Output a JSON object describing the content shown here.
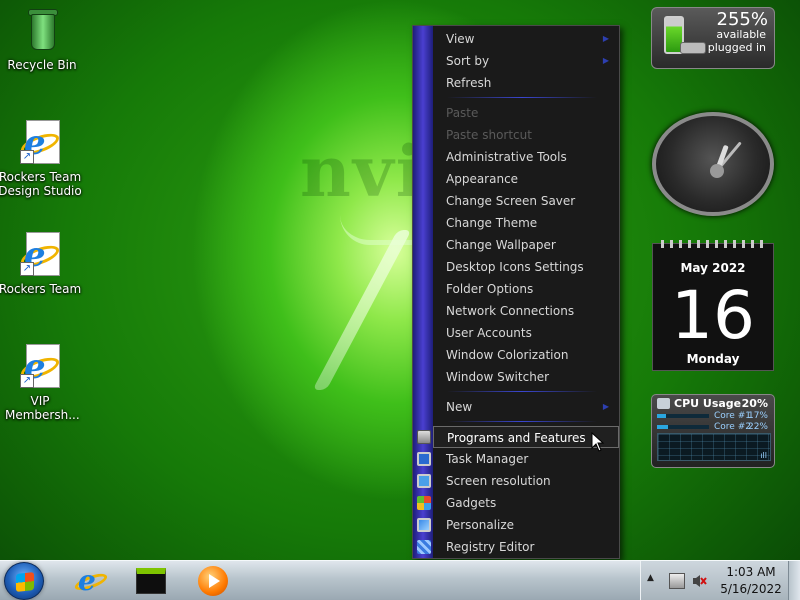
{
  "desktop": {
    "wallpaper_text": "nvi",
    "icons": [
      {
        "label": "Recycle Bin"
      },
      {
        "label": "Rockers Team Design Studio"
      },
      {
        "label": "Rockers Team"
      },
      {
        "label": "VIP Membersh..."
      }
    ]
  },
  "context_menu": {
    "items": [
      {
        "label": "View",
        "submenu": true
      },
      {
        "label": "Sort by",
        "submenu": true
      },
      {
        "label": "Refresh"
      },
      {
        "label": "Paste",
        "disabled": true
      },
      {
        "label": "Paste shortcut",
        "disabled": true
      },
      {
        "label": "Administrative Tools"
      },
      {
        "label": "Appearance"
      },
      {
        "label": "Change Screen Saver"
      },
      {
        "label": "Change Theme"
      },
      {
        "label": "Change Wallpaper"
      },
      {
        "label": "Desktop Icons Settings"
      },
      {
        "label": "Folder Options"
      },
      {
        "label": "Network Connections"
      },
      {
        "label": "User Accounts"
      },
      {
        "label": "Window Colorization"
      },
      {
        "label": "Window Switcher"
      },
      {
        "label": "New",
        "submenu": true
      },
      {
        "label": "Programs and Features",
        "highlighted": true,
        "icon": "programs-icon"
      },
      {
        "label": "Task Manager",
        "icon": "task-manager-icon"
      },
      {
        "label": "Screen resolution",
        "icon": "screen-resolution-icon"
      },
      {
        "label": "Gadgets",
        "icon": "gadgets-icon"
      },
      {
        "label": "Personalize",
        "icon": "personalize-icon"
      },
      {
        "label": "Registry Editor",
        "icon": "registry-icon"
      }
    ],
    "submenu_arrow": "▶"
  },
  "gadgets": {
    "battery": {
      "percent": "255%",
      "status1": "available",
      "status2": "plugged in"
    },
    "calendar": {
      "month": "May 2022",
      "day": "16",
      "weekday": "Monday"
    },
    "cpu": {
      "title": "CPU Usage",
      "total": "20%",
      "cores": [
        {
          "label": "Core #1",
          "value": "17%",
          "fraction": 0.17
        },
        {
          "label": "Core #2",
          "value": "22%",
          "fraction": 0.22
        }
      ],
      "graph_label": "ıll"
    }
  },
  "taskbar": {
    "pinned": [
      "internet-explorer-icon",
      "nvidia-icon",
      "media-player-icon"
    ],
    "tray": {
      "up_arrow": "▲",
      "time": "1:03 AM",
      "date": "5/16/2022"
    }
  },
  "colors": {
    "menu_bg": "#1a1a1a",
    "menu_strip": "#4a3fd0",
    "separator": "#3a46d0",
    "wallpaper_accent": "#8fe84a"
  }
}
